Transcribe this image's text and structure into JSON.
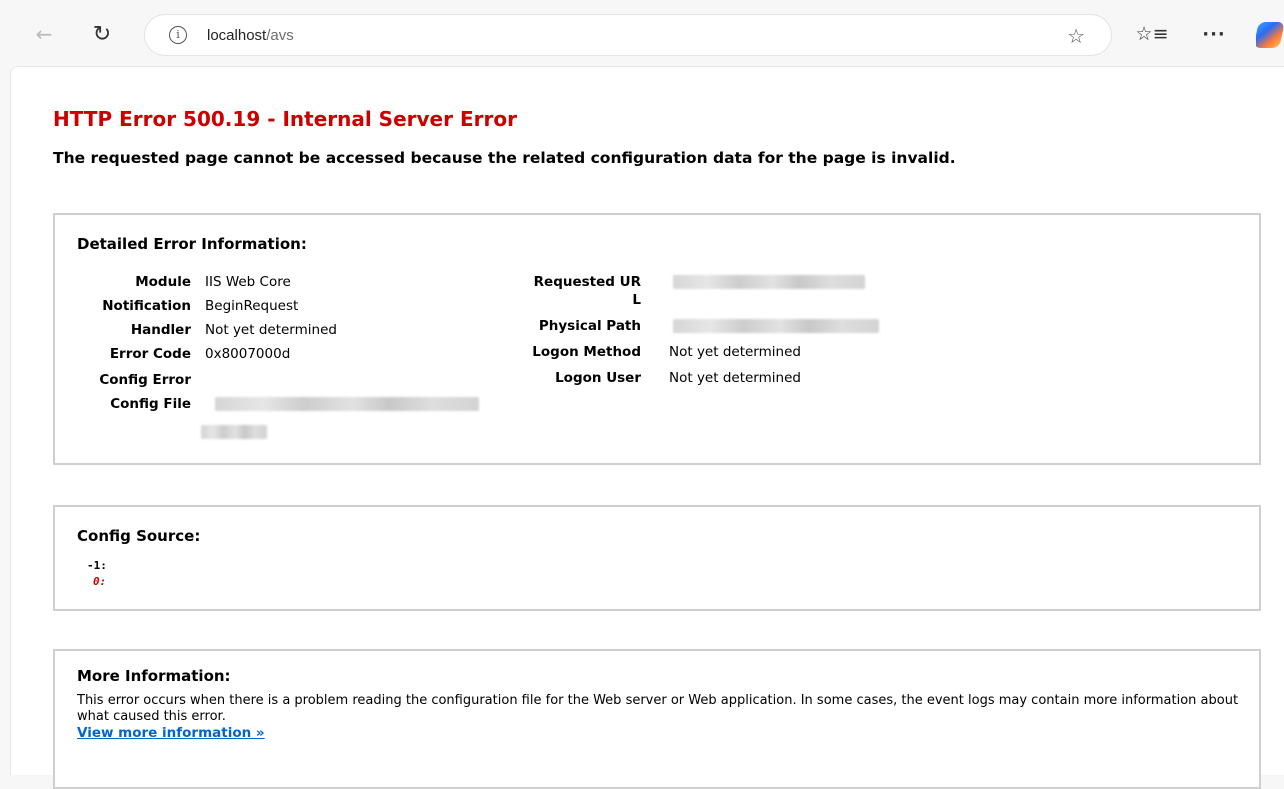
{
  "browser": {
    "url_host": "localhost",
    "url_path": "/avs",
    "back_glyph": "←",
    "refresh_glyph": "↻",
    "info_glyph": "i",
    "star_glyph": "☆",
    "favorites_glyph": "☆≡",
    "more_glyph": "···"
  },
  "page": {
    "title": "HTTP Error 500.19 - Internal Server Error",
    "subtitle": "The requested page cannot be accessed because the related configuration data for the page is invalid."
  },
  "detailed": {
    "heading": "Detailed Error Information:",
    "left": [
      {
        "label": "Module",
        "value": "IIS Web Core"
      },
      {
        "label": "Notification",
        "value": "BeginRequest"
      },
      {
        "label": "Handler",
        "value": "Not yet determined"
      },
      {
        "label": "Error Code",
        "value": "0x8007000d"
      },
      {
        "label": "Config Error",
        "value": ""
      },
      {
        "label": "Config File",
        "value": ""
      }
    ],
    "right": [
      {
        "label_line1": "Requested UR",
        "label_line2": "L",
        "value": ""
      },
      {
        "label": "Physical Path",
        "value": ""
      },
      {
        "label": "Logon Method",
        "value": "Not yet determined"
      },
      {
        "label": "Logon User",
        "value": "Not yet determined"
      }
    ]
  },
  "config_source": {
    "heading": "Config Source:",
    "lines": [
      {
        "num": "-1:",
        "style": "dark"
      },
      {
        "num": "0:",
        "style": "red"
      }
    ]
  },
  "more_info": {
    "heading": "More Information:",
    "text": "This error occurs when there is a problem reading the configuration file for the Web server or Web application. In some cases, the event logs may contain more information about what caused this error.",
    "link": "View more information »"
  },
  "colors": {
    "error_red": "#cc0000",
    "link_blue": "#0066cc",
    "box_border": "#cfcfcf"
  }
}
